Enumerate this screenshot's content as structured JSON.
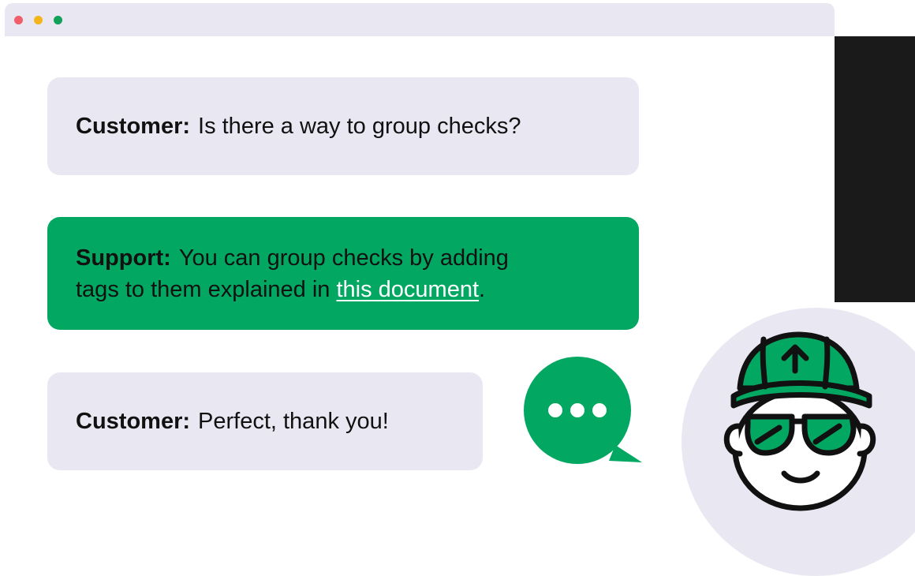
{
  "window": {
    "controls": [
      {
        "name": "close",
        "color": "#f05e6a"
      },
      {
        "name": "minimize",
        "color": "#f4b41a"
      },
      {
        "name": "maximize",
        "color": "#12a15a"
      }
    ]
  },
  "messages": [
    {
      "speaker": "Customer:",
      "text": "Is there a way to group checks?"
    },
    {
      "speaker": "Support:",
      "text_line1": "You can group checks by adding",
      "text_line2_before": "tags to them explained in ",
      "link": "this document",
      "text_line2_after": "."
    },
    {
      "speaker": "Customer:",
      "text": "Perfect, thank you!"
    }
  ],
  "colors": {
    "brand_green": "#02a862",
    "bubble_gray": "#e9e7f1",
    "text_dark": "#111111"
  },
  "icons": {
    "typing": "typing-indicator-icon",
    "avatar": "support-agent-avatar-icon"
  }
}
